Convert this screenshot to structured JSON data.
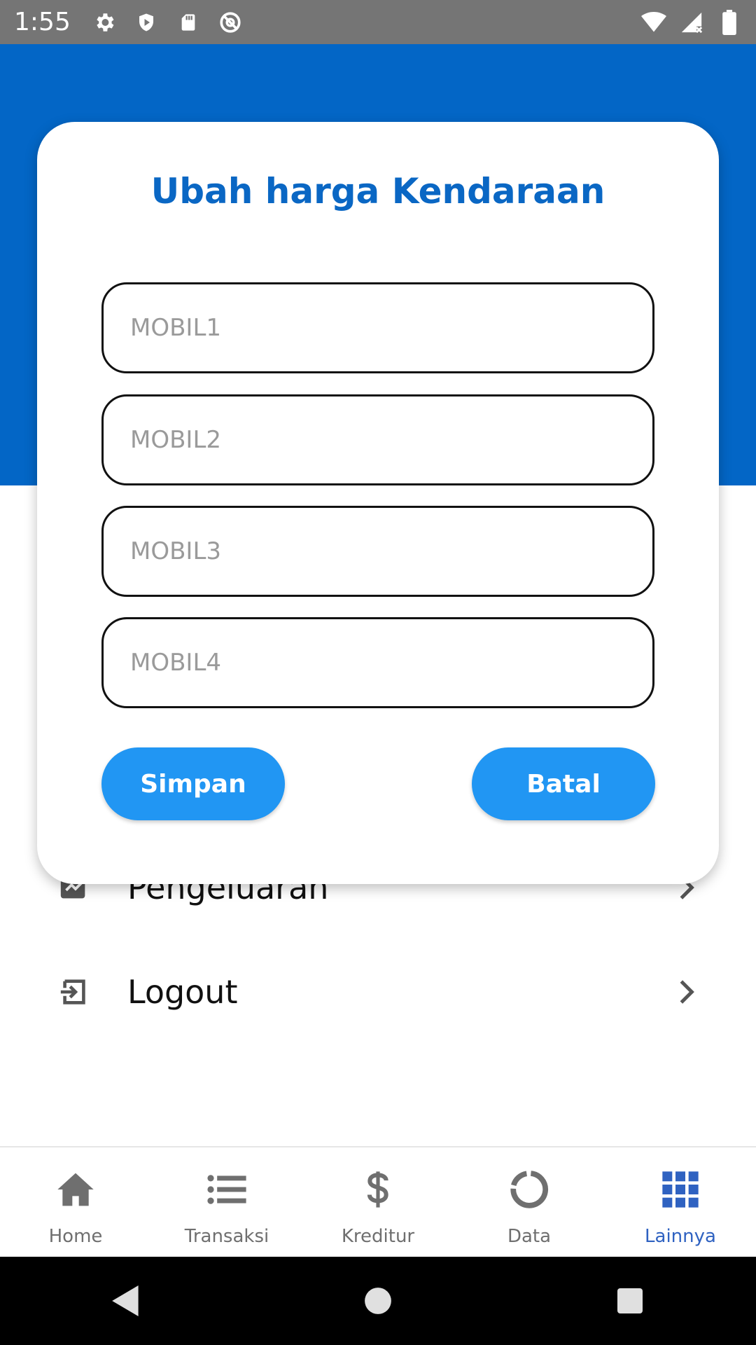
{
  "status_bar": {
    "time": "1:55",
    "icons_left": [
      "settings-icon",
      "shield-icon",
      "sd-card-icon",
      "at-sign-icon"
    ],
    "icons_right": [
      "wifi-icon",
      "signal-icon",
      "battery-icon"
    ]
  },
  "menu": {
    "items": [
      {
        "label": "Pengeluaran",
        "icon": "expense-icon"
      },
      {
        "label": "Logout",
        "icon": "logout-icon"
      }
    ]
  },
  "dialog": {
    "title": "Ubah harga Kendaraan",
    "fields": [
      {
        "placeholder": "MOBIL1",
        "value": ""
      },
      {
        "placeholder": "MOBIL2",
        "value": ""
      },
      {
        "placeholder": "MOBIL3",
        "value": ""
      },
      {
        "placeholder": "MOBIL4",
        "value": ""
      }
    ],
    "save_label": "Simpan",
    "cancel_label": "Batal"
  },
  "bottom_nav": {
    "items": [
      {
        "label": "Home",
        "icon": "home-icon"
      },
      {
        "label": "Transaksi",
        "icon": "list-icon"
      },
      {
        "label": "Kreditur",
        "icon": "dollar-icon"
      },
      {
        "label": "Data",
        "icon": "donut-chart-icon"
      },
      {
        "label": "Lainnya",
        "icon": "grid-icon"
      }
    ],
    "active": "Lainnya"
  },
  "colors": {
    "header_blue": "#0366c6",
    "title_blue": "#0a67c4",
    "button_blue": "#2196f3",
    "nav_active": "#2f62c1",
    "nav_inactive": "#6f6f6f"
  }
}
